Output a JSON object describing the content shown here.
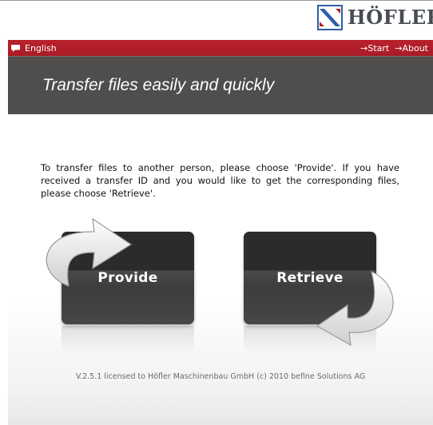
{
  "brand": {
    "name": "HÖFLER",
    "color": "#474c51"
  },
  "topbar": {
    "language": "English",
    "links": [
      "→Start",
      "→About"
    ],
    "color": "#b8212c"
  },
  "header": {
    "title": "Transfer files easily and quickly"
  },
  "intro": "To transfer files to another person, please choose 'Provide'. If you have received a transfer ID and you would like to get the corresponding files, please choose 'Retrieve'.",
  "actions": {
    "provide": {
      "label": "Provide",
      "icon": "curved-arrow-right-icon"
    },
    "retrieve": {
      "label": "Retrieve",
      "icon": "curved-arrow-left-icon"
    }
  },
  "footer": "V.2.5.1 licensed to Höfler Maschinenbau GmbH (c) 2010 befine Solutions AG"
}
